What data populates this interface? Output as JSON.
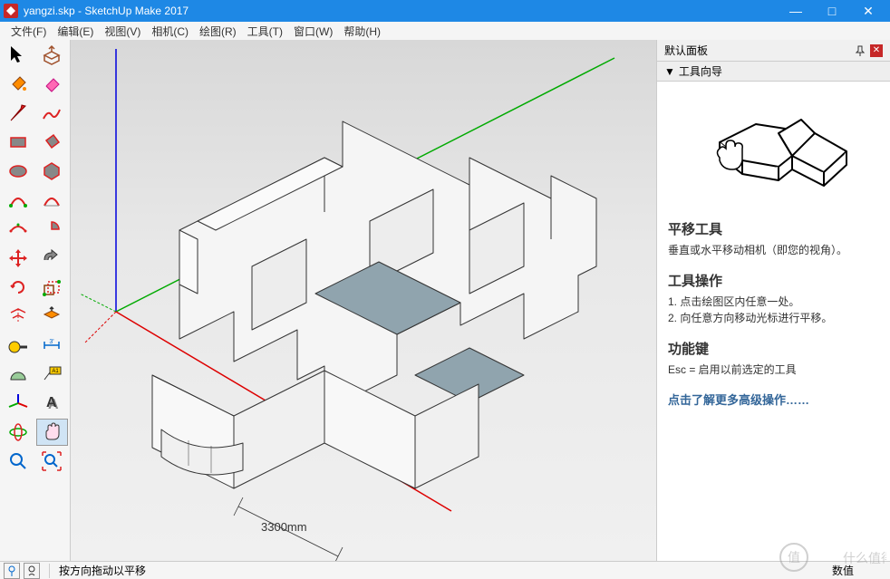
{
  "titlebar": {
    "title": "yangzi.skp - SketchUp Make 2017",
    "minimize": "—",
    "maximize": "□",
    "close": "✕"
  },
  "menubar": {
    "items": [
      {
        "label": "文件(F)"
      },
      {
        "label": "编辑(E)"
      },
      {
        "label": "视图(V)"
      },
      {
        "label": "相机(C)"
      },
      {
        "label": "绘图(R)"
      },
      {
        "label": "工具(T)"
      },
      {
        "label": "窗口(W)"
      },
      {
        "label": "帮助(H)"
      }
    ]
  },
  "toolbar_icons": [
    [
      "select-icon",
      "push-pull-icon"
    ],
    [
      "paint-bucket-icon",
      "eraser-icon"
    ],
    [
      "line-icon",
      "freehand-icon"
    ],
    [
      "rectangle-icon",
      "rotated-rect-icon"
    ],
    [
      "circle-icon",
      "polygon-icon"
    ],
    [
      "arc-icon",
      "two-point-arc-icon"
    ],
    [
      "three-point-arc-icon",
      "pie-icon"
    ],
    [
      "move-icon",
      "follow-me-icon"
    ],
    [
      "rotate-icon",
      "scale-icon"
    ],
    [
      "offset-icon",
      "section-icon"
    ],
    [
      "tape-measure-icon",
      "dimension-icon"
    ],
    [
      "protractor-icon",
      "text-icon"
    ],
    [
      "axes-icon",
      "3d-text-icon"
    ],
    [
      "orbit-icon",
      "pan-icon"
    ],
    [
      "zoom-icon",
      "zoom-extents-icon"
    ]
  ],
  "viewport": {
    "dimension": "3300mm"
  },
  "panel": {
    "header": "默认面板",
    "subheader": "工具向导",
    "collapse": "▼",
    "tool_name": "平移工具",
    "tool_desc": "垂直或水平移动相机（即您的视角）。",
    "operation_title": "工具操作",
    "operation_1": "1. 点击绘图区内任意一处。",
    "operation_2": "2. 向任意方向移动光标进行平移。",
    "function_title": "功能键",
    "function_text": "Esc = 启用以前选定的工具",
    "link": "点击了解更多高级操作……"
  },
  "statusbar": {
    "message": "按方向拖动以平移",
    "field_label": "数值"
  },
  "watermark": "什么值得买"
}
